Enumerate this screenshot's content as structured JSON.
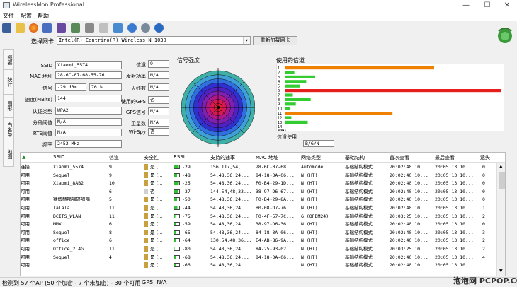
{
  "app": {
    "title": "WirelessMon Professional"
  },
  "window_controls": {
    "minimize": "—",
    "maximize": "☐",
    "close": "✕"
  },
  "menu": [
    "文件",
    "配置",
    "帮助"
  ],
  "nic": {
    "label": "选择网卡",
    "value": "Intel(R) Centrino(R) Wireless-N 1030",
    "reload": "重新加载网卡"
  },
  "side_tabs": [
    "概要",
    "统计",
    "图形",
    "白名单",
    "地图"
  ],
  "info": {
    "ssid_label": "SSID",
    "ssid": "Xiaomi_5574",
    "mac_label": "MAC 地址",
    "mac": "28-6C-07-68-55-76",
    "signal_label": "信号",
    "signal_dbm": "-29 dBm",
    "signal_pct": "76 %",
    "speed_label": "速度(MBits)",
    "speed": "144",
    "auth_label": "认证类型",
    "auth": "WPA2",
    "frag_label": "分段阈值",
    "frag": "N/A",
    "rts_label": "RTS阈值",
    "rts": "N/A",
    "freq_label": "频率",
    "freq": "2452 MHz",
    "channel_label": "信道",
    "channel": "9",
    "txpower_label": "发射功率",
    "txpower": "N/A",
    "antenna_label": "天线数",
    "antenna": "N/A",
    "gps_used_label": "使用的GPS",
    "gps_used": "否",
    "gps_signal_label": "GPS信号",
    "gps_signal": "N/A",
    "satellites_label": "卫星数",
    "satellites": "N/A",
    "wispy_label": "Wi-Spy",
    "wispy": "否"
  },
  "signal_panel": {
    "title": "信号强度"
  },
  "channel_panel": {
    "title": "使用的信道",
    "labels": [
      "1",
      "2",
      "3",
      "4",
      "5",
      "6",
      "7",
      "8",
      "9",
      "10",
      "11",
      "12",
      "13",
      "14",
      "OTH"
    ],
    "sel_label": "信道使用",
    "sel_value": "B/G/N"
  },
  "channel_bars": [
    {
      "ch": "1",
      "color": "#f08000",
      "value": 1.0
    },
    {
      "ch": "2",
      "color": "#33cc33",
      "value": 0.06
    },
    {
      "ch": "3",
      "color": "#33cc33",
      "value": 0.2
    },
    {
      "ch": "4",
      "color": "#33cc33",
      "value": 0.14
    },
    {
      "ch": "5",
      "color": "#33cc33",
      "value": 0.1
    },
    {
      "ch": "6",
      "color": "#e61e1e",
      "value": 1.45
    },
    {
      "ch": "7",
      "color": "#33cc33",
      "value": 0.05
    },
    {
      "ch": "8",
      "color": "#33cc33",
      "value": 0.17
    },
    {
      "ch": "9",
      "color": "#33cc33",
      "value": 0.07
    },
    {
      "ch": "10",
      "color": "#33cc33",
      "value": 0.03
    },
    {
      "ch": "11",
      "color": "#f08000",
      "value": 0.72
    },
    {
      "ch": "12",
      "color": "#33cc33",
      "value": 0.04
    },
    {
      "ch": "13",
      "color": "#33cc33",
      "value": 0.15
    }
  ],
  "table": {
    "headers": [
      "▲",
      "SSID",
      "信道",
      "安全性",
      "RSSI",
      "支持的速率",
      "MAC 地址",
      "网络类型",
      "基础结构",
      "首次查看",
      "最后查看",
      "遗失"
    ],
    "rows": [
      {
        "status": "连接",
        "ssid": "Xiaomi_5574",
        "ch": "9",
        "sec": "是 (…",
        "rssi": "-29",
        "sig": 0.9,
        "rate": "156,117,54,...",
        "mac": "28-6C-07-68...",
        "type": "Automode",
        "infra": "基础结构模式",
        "first": "20:02:40 10...",
        "last": "20:05:13 10...",
        "lost": "0"
      },
      {
        "status": "可用",
        "ssid": "Sequel",
        "ch": "9",
        "sec": "是 (…",
        "rssi": "-48",
        "sig": 0.6,
        "rate": "54,48,36,24...",
        "mac": "84-18-3A-06...",
        "type": "N (HT)",
        "infra": "基础结构模式",
        "first": "20:02:40 10...",
        "last": "20:05:13 10...",
        "lost": "0"
      },
      {
        "status": "可用",
        "ssid": "Xiaomi_8AB2",
        "ch": "10",
        "sec": "是 (…",
        "rssi": "-25",
        "sig": 0.95,
        "rate": "54,48,36,24...",
        "mac": "F0-B4-29-1D...",
        "type": "N (HT)",
        "infra": "基础结构模式",
        "first": "20:02:40 10...",
        "last": "20:05:13 10...",
        "lost": "0"
      },
      {
        "status": "可用",
        "ssid": "",
        "ch": "6",
        "sec": "否",
        "rssi": "-37",
        "sig": 0.75,
        "rate": "144,54,48,33...",
        "mac": "38-97-D6-67...",
        "type": "N (HT)",
        "infra": "基础结构模式",
        "first": "20:02:40 10...",
        "last": "20:05:13 10...",
        "lost": "0"
      },
      {
        "status": "可用",
        "ssid": "赛博赫嘀嘀碟嘀嘀",
        "ch": "5",
        "sec": "是 (…",
        "rssi": "-50",
        "sig": 0.55,
        "rate": "54,48,36,24...",
        "mac": "F0-B4-29-8A...",
        "type": "N (HT)",
        "infra": "基础结构模式",
        "first": "20:02:40 10...",
        "last": "20:05:13 10...",
        "lost": "0"
      },
      {
        "status": "可用",
        "ssid": "lalala",
        "ch": "11",
        "sec": "是 (…",
        "rssi": "-44",
        "sig": 0.65,
        "rate": "54,48,36,24...",
        "mac": "B0-08-D7-76...",
        "type": "N (HT)",
        "infra": "基础结构模式",
        "first": "20:02:40 10...",
        "last": "20:05:13 10...",
        "lost": "1"
      },
      {
        "status": "可用",
        "ssid": "DCITS_WLAN",
        "ch": "11",
        "sec": "是 (…",
        "rssi": "-75",
        "sig": 0.2,
        "rate": "54,48,36,24...",
        "mac": "F0-4F-57-7C...",
        "type": "G (OFDM24)",
        "infra": "基础结构模式",
        "first": "20:03:25 10...",
        "last": "20:05:13 10...",
        "lost": "2"
      },
      {
        "status": "可用",
        "ssid": "MMX",
        "ch": "6",
        "sec": "是 (…",
        "rssi": "-59",
        "sig": 0.4,
        "rate": "54,48,36,24...",
        "mac": "38-97-D6-36...",
        "type": "N (HT)",
        "infra": "基础结构模式",
        "first": "20:02:40 10...",
        "last": "20:05:13 10...",
        "lost": "0"
      },
      {
        "status": "可用",
        "ssid": "Sequel",
        "ch": "8",
        "sec": "是 (…",
        "rssi": "-65",
        "sig": 0.35,
        "rate": "54,48,36,24...",
        "mac": "84-18-3A-06...",
        "type": "N (HT)",
        "infra": "基础结构模式",
        "first": "20:02:40 10...",
        "last": "20:05:13 10...",
        "lost": "3"
      },
      {
        "status": "可用",
        "ssid": "office",
        "ch": "6",
        "sec": "是 (…",
        "rssi": "-64",
        "sig": 0.35,
        "rate": "130,54,48,36...",
        "mac": "E4-AB-B6-9A...",
        "type": "N (HT)",
        "infra": "基础结构模式",
        "first": "20:02:40 10...",
        "last": "20:05:13 10...",
        "lost": "2"
      },
      {
        "status": "可用",
        "ssid": "Office_2.4G",
        "ch": "11",
        "sec": "是 (…",
        "rssi": "-80",
        "sig": 0.1,
        "rate": "54,48,36,24...",
        "mac": "8A-25-93-02...",
        "type": "N (HT)",
        "infra": "基础结构模式",
        "first": "20:03:25 10...",
        "last": "20:05:13 10...",
        "lost": "2"
      },
      {
        "status": "可用",
        "ssid": "Sequel",
        "ch": "4",
        "sec": "是 (…",
        "rssi": "-68",
        "sig": 0.3,
        "rate": "54,48,36,24...",
        "mac": "84-18-3A-06...",
        "type": "N (HT)",
        "infra": "基础结构模式",
        "first": "20:02:40 10...",
        "last": "20:05:13 10...",
        "lost": "4"
      },
      {
        "status": "可用",
        "ssid": "",
        "ch": "",
        "sec": "是 (…",
        "rssi": "-66",
        "sig": 0.3,
        "rate": "54,48,36,24...",
        "mac": "",
        "type": "N (HT)",
        "infra": "基础结构模式",
        "first": "20:02:40 10...",
        "last": "20:05:13 10...",
        "lost": ""
      }
    ]
  },
  "status": {
    "text": "检测到 57 个AP (50 个加密 - 7 个未加密) - 30 个可用",
    "gps": "GPS: N/A"
  },
  "watermark": "泡泡网 PCPOP.COM"
}
